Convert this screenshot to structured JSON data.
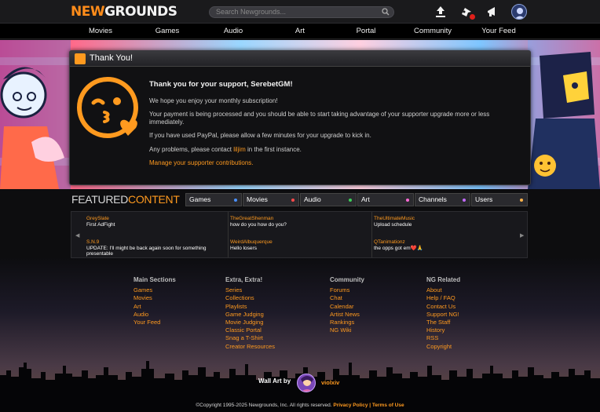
{
  "header": {
    "logo_new": "NEW",
    "logo_grounds": "GROUNDS",
    "search_placeholder": "Search Newgrounds...",
    "notification_count": "1"
  },
  "nav": [
    "Movies",
    "Games",
    "Audio",
    "Art",
    "Portal",
    "Community",
    "Your Feed"
  ],
  "dialog": {
    "title": "Thank You!",
    "heading": "Thank you for your support, SerebetGM!",
    "p1": "We hope you enjoy your monthly subscription!",
    "p2": "Your payment is being processed and you should be able to start taking advantage of your supporter upgrade more or less immediately.",
    "p3": "If you have used PayPal, please allow a few minutes for your upgrade to kick in.",
    "p4_before": "Any problems, please contact",
    "p4_link": "liljim",
    "p4_after": "in the first instance.",
    "manage": "Manage your supporter contributions."
  },
  "featured": {
    "title_a": "FEATURED",
    "title_b": "CONTENT",
    "tabs": [
      {
        "label": "Games",
        "dot": "#4a90ff"
      },
      {
        "label": "Movies",
        "dot": "#ff4a4a"
      },
      {
        "label": "Audio",
        "dot": "#3ccf5a"
      },
      {
        "label": "Art",
        "dot": "#ff6ad5"
      },
      {
        "label": "Channels",
        "dot": "#c26aff"
      },
      {
        "label": "Users",
        "dot": "#ffb34a"
      }
    ],
    "items": [
      {
        "author": "GreySlate",
        "title": "First AdFight"
      },
      {
        "author": "TheGreatShenman",
        "title": "how do you how do you?"
      },
      {
        "author": "TheUltimateMusic",
        "title": "Upload schedule"
      },
      {
        "author": "S.N.9",
        "title": "UPDATE: I'll might be back again soon for something presentable"
      },
      {
        "author": "WeirdAlbuquerque",
        "title": "Hello losers"
      },
      {
        "author": "QTanimationz",
        "title": "the opps got em❤️🙏"
      }
    ]
  },
  "footer": {
    "columns": [
      {
        "heading": "Main Sections",
        "links": [
          "Games",
          "Movies",
          "Art",
          "Audio",
          "Your Feed"
        ]
      },
      {
        "heading": "Extra, Extra!",
        "links": [
          "Series",
          "Collections",
          "Playlists",
          "Game Judging",
          "Movie Judging",
          "Classic Portal",
          "Snag a T-Shirt",
          "Creator Resources"
        ]
      },
      {
        "heading": "Community",
        "links": [
          "Forums",
          "Chat",
          "Calendar",
          "Artist News",
          "Rankings",
          "NG Wiki"
        ]
      },
      {
        "heading": "NG Related",
        "links": [
          "About",
          "Help / FAQ",
          "Contact Us",
          "Support NG!",
          "The Staff",
          "History",
          "RSS",
          "Copyright"
        ]
      }
    ],
    "wall_art_label": "Wall Art by",
    "wall_art_user": "violxiv",
    "copyright_text": "©Copyright 1995-2025 Newgrounds, Inc. All rights reserved.",
    "privacy": "Privacy Policy",
    "sep": "|",
    "terms": "Terms of Use"
  },
  "colors": {
    "accent": "#ff9a1f",
    "background": "#0d0d0f"
  }
}
